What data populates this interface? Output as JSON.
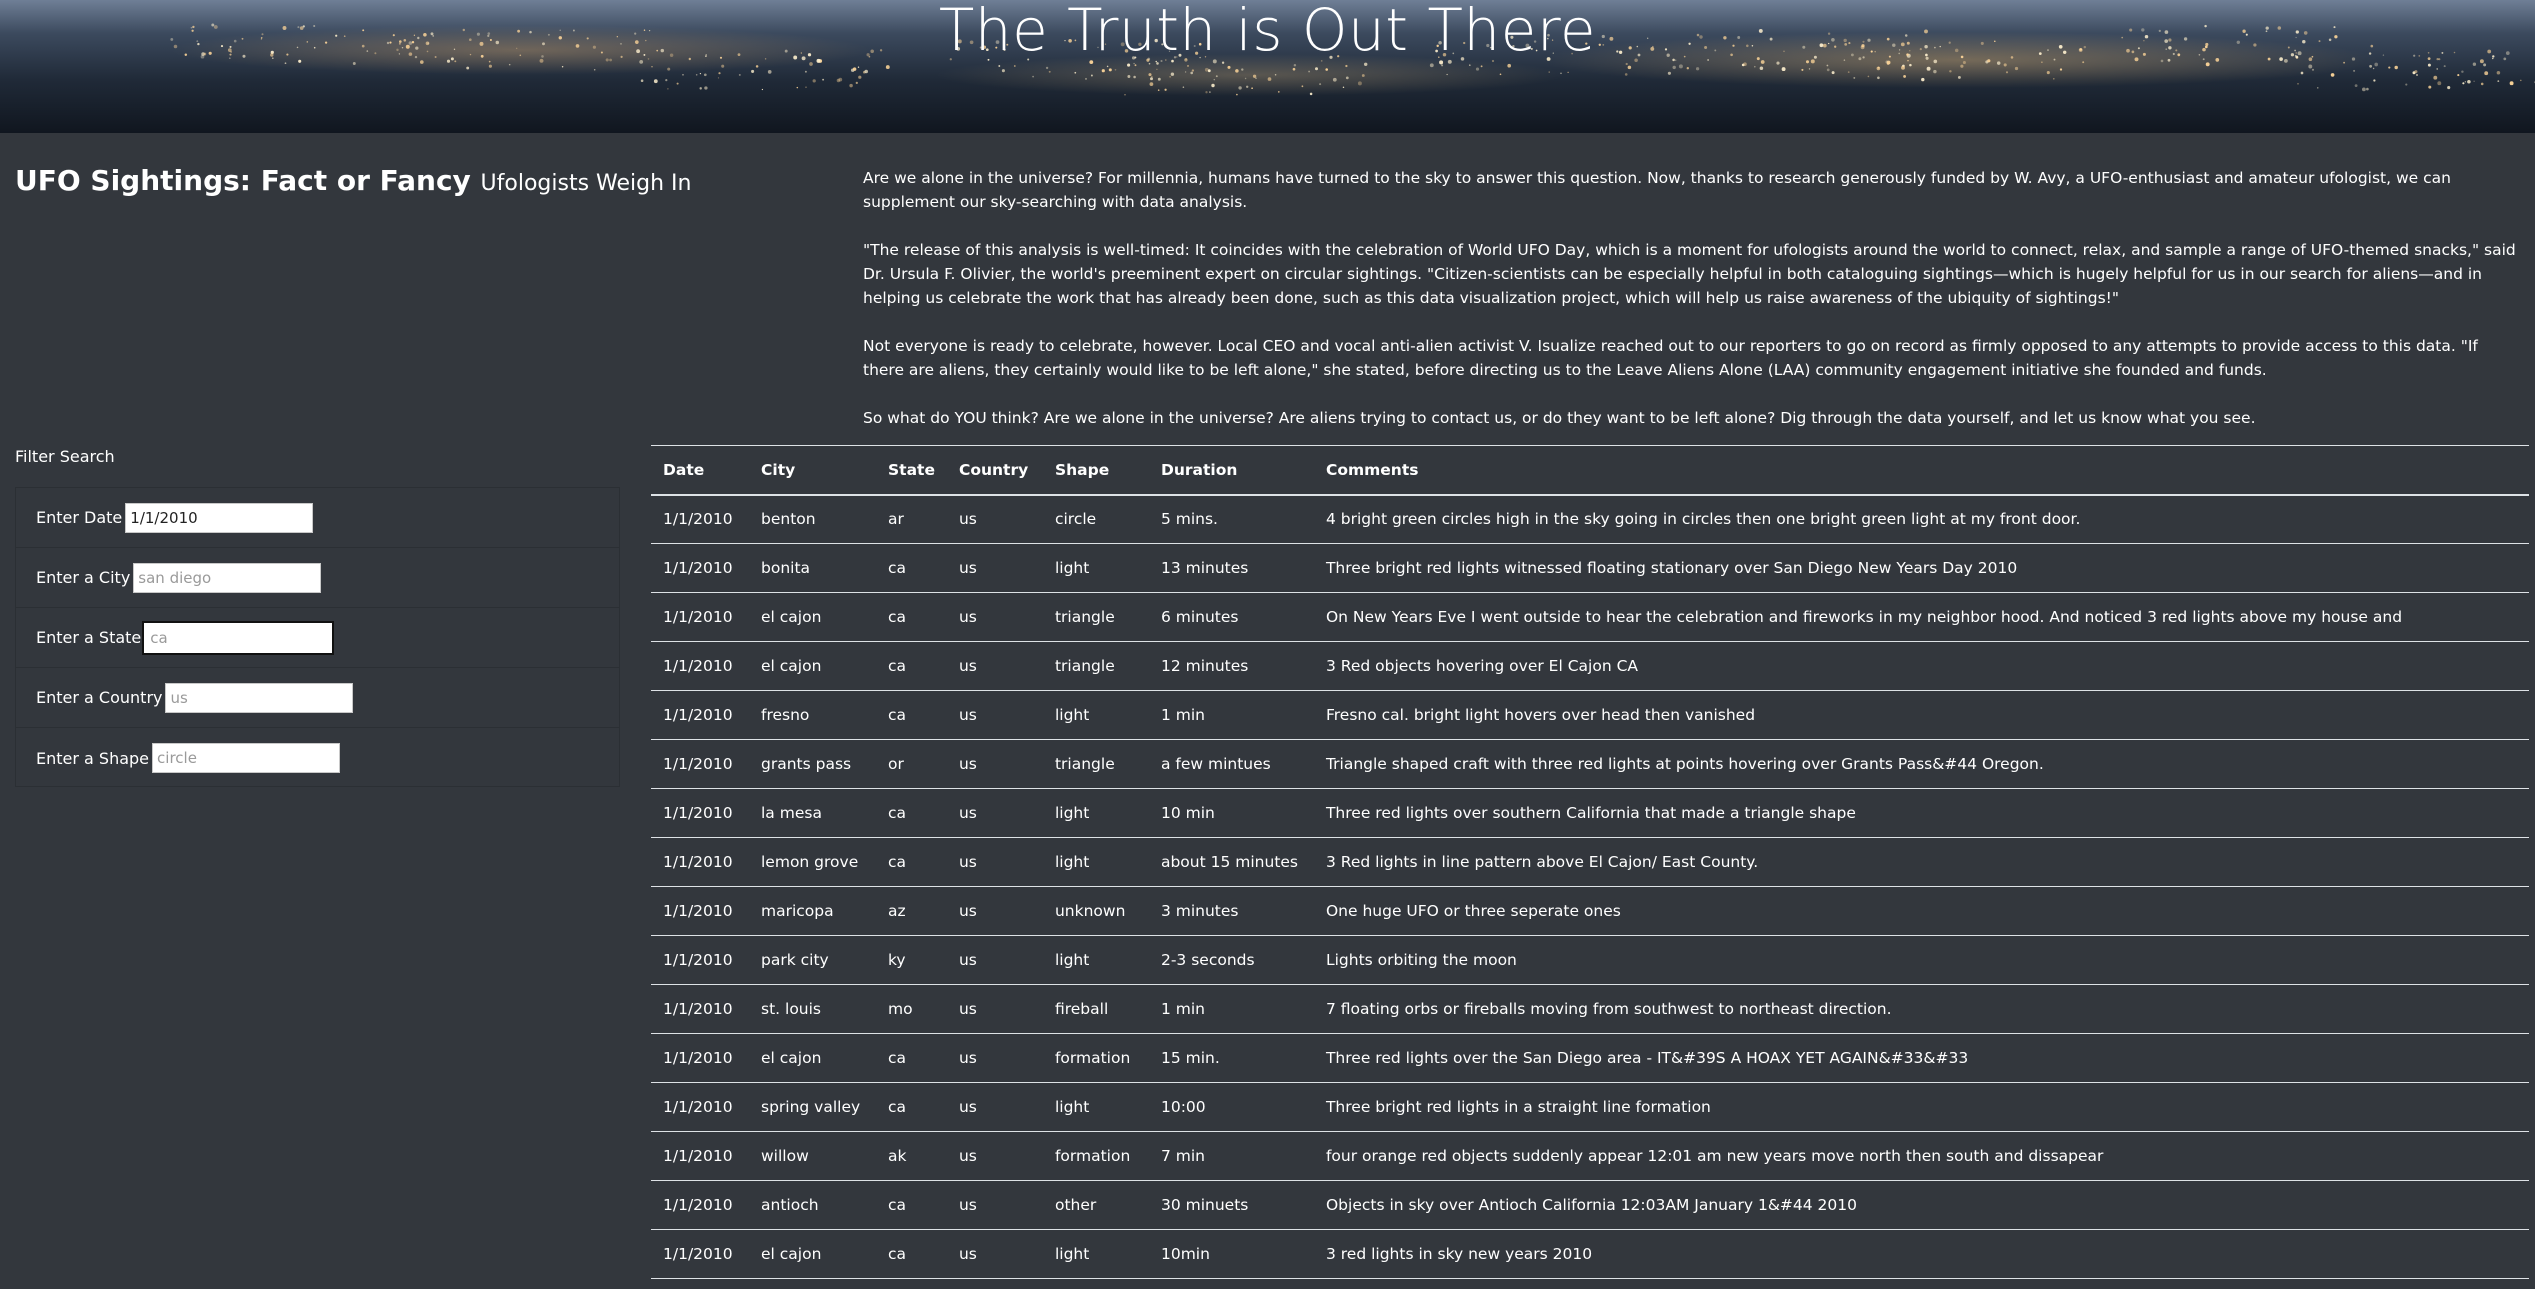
{
  "header": {
    "title": "The Truth is Out There"
  },
  "lead": {
    "title": "UFO Sightings: Fact or Fancy",
    "subtitle": "Ufologists Weigh In"
  },
  "article": {
    "paragraphs": [
      "Are we alone in the universe? For millennia, humans have turned to the sky to answer this question. Now, thanks to research generously funded by W. Avy, a UFO-enthusiast and amateur ufologist, we can supplement our sky-searching with data analysis.",
      "\"The release of this analysis is well-timed: It coincides with the celebration of World UFO Day, which is a moment for ufologists around the world to connect, relax, and sample a range of UFO-themed snacks,\" said Dr. Ursula F. Olivier, the world's preeminent expert on circular sightings. \"Citizen-scientists can be especially helpful in both cataloguing sightings—which is hugely helpful for us in our search for aliens—and in helping us celebrate the work that has already been done, such as this data visualization project, which will help us raise awareness of the ubiquity of sightings!\"",
      "Not everyone is ready to celebrate, however. Local CEO and vocal anti-alien activist V. Isualize reached out to our reporters to go on record as firmly opposed to any attempts to provide access to this data. \"If there are aliens, they certainly would like to be left alone,\" she stated, before directing us to the Leave Aliens Alone (LAA) community engagement initiative she founded and funds.",
      "So what do YOU think? Are we alone in the universe? Are aliens trying to contact us, or do they want to be left alone? Dig through the data yourself, and let us know what you see."
    ]
  },
  "filters": {
    "title": "Filter Search",
    "date": {
      "label": "Enter Date",
      "value": "1/1/2010",
      "placeholder": "1/1/2010"
    },
    "city": {
      "label": "Enter a City",
      "value": "",
      "placeholder": "san diego"
    },
    "state": {
      "label": "Enter a State",
      "value": "",
      "placeholder": "ca"
    },
    "country": {
      "label": "Enter a Country",
      "value": "",
      "placeholder": "us"
    },
    "shape": {
      "label": "Enter a Shape",
      "value": "",
      "placeholder": "circle"
    }
  },
  "table": {
    "headers": [
      "Date",
      "City",
      "State",
      "Country",
      "Shape",
      "Duration",
      "Comments"
    ],
    "rows": [
      [
        "1/1/2010",
        "benton",
        "ar",
        "us",
        "circle",
        "5 mins.",
        "4 bright green circles high in the sky going in circles then one bright green light at my front door."
      ],
      [
        "1/1/2010",
        "bonita",
        "ca",
        "us",
        "light",
        "13 minutes",
        "Three bright red lights witnessed floating stationary over San Diego New Years Day 2010"
      ],
      [
        "1/1/2010",
        "el cajon",
        "ca",
        "us",
        "triangle",
        "6 minutes",
        "On New Years Eve I went outside to hear the celebration and fireworks in my neighbor hood. And noticed 3 red lights above my house and"
      ],
      [
        "1/1/2010",
        "el cajon",
        "ca",
        "us",
        "triangle",
        "12 minutes",
        "3 Red objects hovering over El Cajon CA"
      ],
      [
        "1/1/2010",
        "fresno",
        "ca",
        "us",
        "light",
        "1 min",
        "Fresno cal. bright light hovers over head then vanished"
      ],
      [
        "1/1/2010",
        "grants pass",
        "or",
        "us",
        "triangle",
        "a few mintues",
        "Triangle shaped craft with three red lights at points hovering over Grants Pass&#44 Oregon."
      ],
      [
        "1/1/2010",
        "la mesa",
        "ca",
        "us",
        "light",
        "10 min",
        "Three red lights over southern California that made a triangle shape"
      ],
      [
        "1/1/2010",
        "lemon grove",
        "ca",
        "us",
        "light",
        "about 15 minutes",
        "3 Red lights in line pattern above El Cajon/ East County."
      ],
      [
        "1/1/2010",
        "maricopa",
        "az",
        "us",
        "unknown",
        "3 minutes",
        "One huge UFO or three seperate ones"
      ],
      [
        "1/1/2010",
        "park city",
        "ky",
        "us",
        "light",
        "2-3 seconds",
        "Lights orbiting the moon"
      ],
      [
        "1/1/2010",
        "st. louis",
        "mo",
        "us",
        "fireball",
        "1 min",
        "7 floating orbs or fireballs moving from southwest to northeast direction."
      ],
      [
        "1/1/2010",
        "el cajon",
        "ca",
        "us",
        "formation",
        "15 min.",
        "Three red lights over the San Diego area - IT&#39S A HOAX YET AGAIN&#33&#33"
      ],
      [
        "1/1/2010",
        "spring valley",
        "ca",
        "us",
        "light",
        "10:00",
        "Three bright red lights in a straight line formation"
      ],
      [
        "1/1/2010",
        "willow",
        "ak",
        "us",
        "formation",
        "7 min",
        "four orange red objects suddenly appear 12:01 am new years move north then south and dissapear"
      ],
      [
        "1/1/2010",
        "antioch",
        "ca",
        "us",
        "other",
        "30 minuets",
        "Objects in sky over Antioch California 12:03AM January 1&#44 2010"
      ],
      [
        "1/1/2010",
        "el cajon",
        "ca",
        "us",
        "light",
        "10min",
        "3 red lights in sky new years 2010"
      ]
    ]
  }
}
